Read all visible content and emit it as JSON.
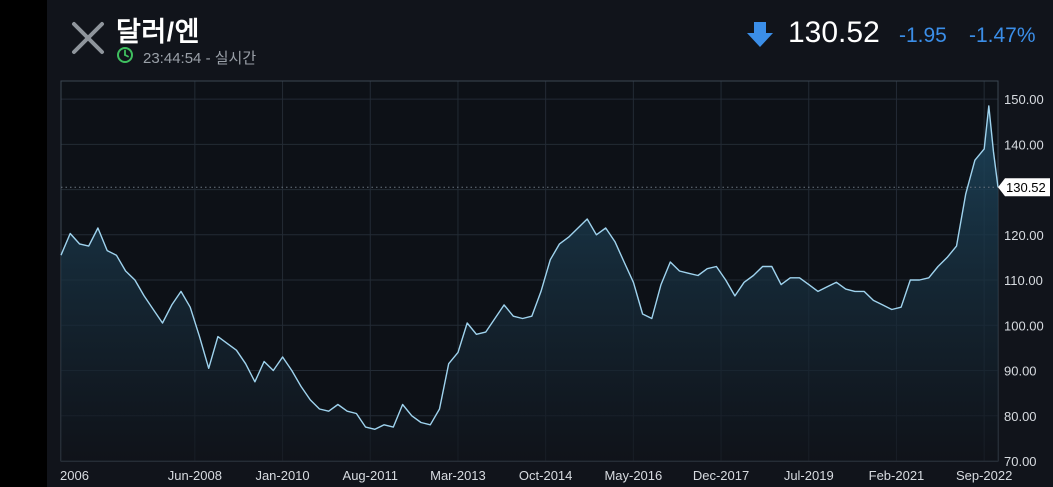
{
  "header": {
    "title": "달러/엔",
    "time": "23:44:54",
    "separator": "-",
    "status": "실시간",
    "price": "130.52",
    "change": "-1.95",
    "change_pct": "-1.47%",
    "direction_icon": "arrow-down-icon",
    "close_icon": "close-icon",
    "clock_icon": "clock-icon"
  },
  "colors": {
    "background": "#11141b",
    "line": "#9fd3ee",
    "down": "#3b8ee8",
    "clock": "#3fbf5f"
  },
  "chart_data": {
    "type": "area",
    "title": "",
    "xlabel": "",
    "ylabel": "",
    "ylim": [
      70,
      154
    ],
    "yticks": [
      70,
      80,
      90,
      100,
      110,
      120,
      130,
      140,
      150
    ],
    "ytick_labels": [
      "70.00",
      "80.00",
      "90.00",
      "100.00",
      "110.00",
      "120.00",
      "130.00",
      "140.00",
      "150.00"
    ],
    "xlim": [
      "2006-01",
      "2022-12"
    ],
    "xticks": [
      "2006-01",
      "2008-06",
      "2010-01",
      "2011-08",
      "2013-03",
      "2014-10",
      "2016-05",
      "2017-12",
      "2019-07",
      "2021-02",
      "2022-09"
    ],
    "xtick_labels": [
      "2006",
      "Jun-2008",
      "Jan-2010",
      "Aug-2011",
      "Mar-2013",
      "Oct-2014",
      "May-2016",
      "Dec-2017",
      "Jul-2019",
      "Feb-2021",
      "Sep-2022"
    ],
    "current_value": 130.52,
    "current_label": "130.52",
    "grid": true,
    "series": [
      {
        "x": [
          "2006-01",
          "2006-03",
          "2006-05",
          "2006-07",
          "2006-09",
          "2006-11",
          "2007-01",
          "2007-03",
          "2007-05",
          "2007-07",
          "2007-09",
          "2007-11",
          "2008-01",
          "2008-03",
          "2008-05",
          "2008-07",
          "2008-09",
          "2008-11",
          "2009-01",
          "2009-03",
          "2009-05",
          "2009-07",
          "2009-09",
          "2009-11",
          "2010-01",
          "2010-03",
          "2010-05",
          "2010-07",
          "2010-09",
          "2010-11",
          "2011-01",
          "2011-03",
          "2011-05",
          "2011-07",
          "2011-09",
          "2011-11",
          "2012-01",
          "2012-03",
          "2012-05",
          "2012-07",
          "2012-09",
          "2012-11",
          "2013-01",
          "2013-03",
          "2013-05",
          "2013-07",
          "2013-09",
          "2013-11",
          "2014-01",
          "2014-03",
          "2014-05",
          "2014-07",
          "2014-09",
          "2014-11",
          "2015-01",
          "2015-03",
          "2015-05",
          "2015-07",
          "2015-09",
          "2015-11",
          "2016-01",
          "2016-03",
          "2016-05",
          "2016-07",
          "2016-09",
          "2016-11",
          "2017-01",
          "2017-03",
          "2017-05",
          "2017-07",
          "2017-09",
          "2017-11",
          "2018-01",
          "2018-03",
          "2018-05",
          "2018-07",
          "2018-09",
          "2018-11",
          "2019-01",
          "2019-03",
          "2019-05",
          "2019-07",
          "2019-09",
          "2019-11",
          "2020-01",
          "2020-03",
          "2020-05",
          "2020-07",
          "2020-09",
          "2020-11",
          "2021-01",
          "2021-03",
          "2021-05",
          "2021-07",
          "2021-09",
          "2021-11",
          "2022-01",
          "2022-03",
          "2022-05",
          "2022-07",
          "2022-09",
          "2022-10",
          "2022-11",
          "2022-12"
        ],
        "y": [
          115.5,
          120.3,
          118.0,
          117.5,
          121.5,
          116.5,
          115.5,
          112.0,
          110.0,
          106.5,
          103.5,
          100.5,
          104.5,
          107.5,
          104.0,
          97.5,
          90.5,
          97.5,
          96.0,
          94.5,
          91.5,
          87.5,
          92.0,
          90.0,
          93.0,
          90.0,
          86.5,
          83.5,
          81.5,
          81.0,
          82.5,
          81.0,
          80.5,
          77.5,
          77.0,
          78.0,
          77.5,
          82.5,
          80.0,
          78.5,
          78.0,
          81.5,
          91.5,
          94.0,
          100.5,
          98.0,
          98.5,
          101.5,
          104.5,
          102.0,
          101.5,
          102.0,
          107.5,
          114.5,
          118.0,
          119.5,
          121.5,
          123.5,
          120.0,
          121.5,
          118.5,
          114.0,
          109.5,
          102.5,
          101.5,
          109.0,
          114.0,
          112.0,
          111.5,
          111.0,
          112.5,
          113.0,
          110.0,
          106.5,
          109.5,
          111.0,
          113.0,
          113.0,
          109.0,
          110.5,
          110.5,
          109.0,
          107.5,
          108.5,
          109.5,
          108.0,
          107.5,
          107.5,
          105.5,
          104.5,
          103.5,
          104.0,
          110.0,
          110.0,
          110.5,
          113.0,
          115.0,
          117.5,
          129.0,
          136.5,
          139.0,
          148.5,
          138.5,
          130.5
        ]
      }
    ]
  }
}
